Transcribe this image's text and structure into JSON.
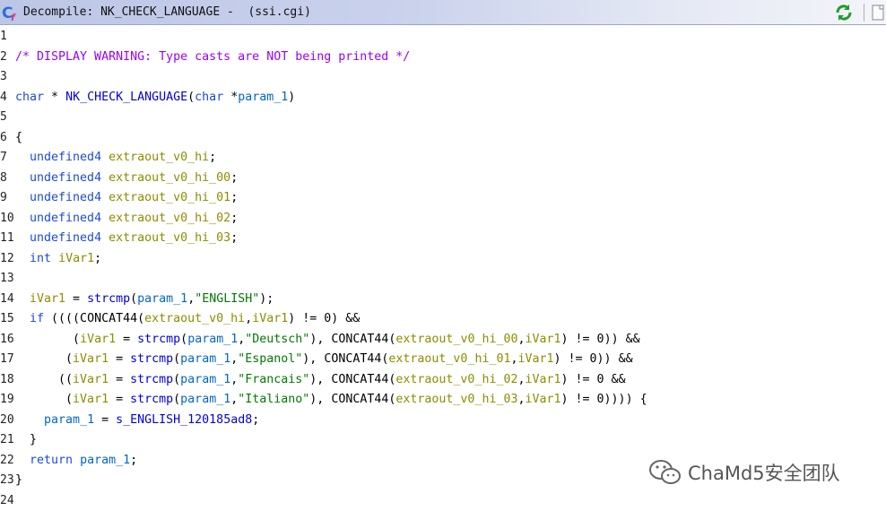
{
  "window": {
    "title": "Decompile: NK_CHECK_LANGUAGE -  (ssi.cgi)",
    "icons": [
      "decompile-icon",
      "refresh-icon",
      "copy-icon"
    ]
  },
  "code": {
    "line_numbers": [
      "1",
      "2",
      "3",
      "4",
      "5",
      "6",
      "7",
      "8",
      "9",
      "10",
      "11",
      "12",
      "13",
      "14",
      "15",
      "16",
      "17",
      "18",
      "19",
      "20",
      "21",
      "22",
      "23",
      "24"
    ],
    "lines": [
      [],
      [
        {
          "t": "/* DISPLAY WARNING: Type casts are NOT being printed */",
          "c": "c"
        }
      ],
      [],
      [
        {
          "t": "char",
          "c": "k"
        },
        {
          "t": " * ",
          "c": "n"
        },
        {
          "t": "NK_CHECK_LANGUAGE",
          "c": "f"
        },
        {
          "t": "(",
          "c": "n"
        },
        {
          "t": "char",
          "c": "k"
        },
        {
          "t": " *",
          "c": "n"
        },
        {
          "t": "param_1",
          "c": "pr"
        },
        {
          "t": ")",
          "c": "n"
        }
      ],
      [],
      [
        {
          "t": "{",
          "c": "n"
        }
      ],
      [
        {
          "t": "  ",
          "c": "n"
        },
        {
          "t": "undefined4",
          "c": "k"
        },
        {
          "t": " ",
          "c": "n"
        },
        {
          "t": "extraout_v0_hi",
          "c": "v"
        },
        {
          "t": ";",
          "c": "n"
        }
      ],
      [
        {
          "t": "  ",
          "c": "n"
        },
        {
          "t": "undefined4",
          "c": "k"
        },
        {
          "t": " ",
          "c": "n"
        },
        {
          "t": "extraout_v0_hi_00",
          "c": "v"
        },
        {
          "t": ";",
          "c": "n"
        }
      ],
      [
        {
          "t": "  ",
          "c": "n"
        },
        {
          "t": "undefined4",
          "c": "k"
        },
        {
          "t": " ",
          "c": "n"
        },
        {
          "t": "extraout_v0_hi_01",
          "c": "v"
        },
        {
          "t": ";",
          "c": "n"
        }
      ],
      [
        {
          "t": "  ",
          "c": "n"
        },
        {
          "t": "undefined4",
          "c": "k"
        },
        {
          "t": " ",
          "c": "n"
        },
        {
          "t": "extraout_v0_hi_02",
          "c": "v"
        },
        {
          "t": ";",
          "c": "n"
        }
      ],
      [
        {
          "t": "  ",
          "c": "n"
        },
        {
          "t": "undefined4",
          "c": "k"
        },
        {
          "t": " ",
          "c": "n"
        },
        {
          "t": "extraout_v0_hi_03",
          "c": "v"
        },
        {
          "t": ";",
          "c": "n"
        }
      ],
      [
        {
          "t": "  ",
          "c": "n"
        },
        {
          "t": "int",
          "c": "k"
        },
        {
          "t": " ",
          "c": "n"
        },
        {
          "t": "iVar1",
          "c": "v"
        },
        {
          "t": ";",
          "c": "n"
        }
      ],
      [],
      [
        {
          "t": "  ",
          "c": "n"
        },
        {
          "t": "iVar1",
          "c": "v"
        },
        {
          "t": " = ",
          "c": "n"
        },
        {
          "t": "strcmp",
          "c": "f"
        },
        {
          "t": "(",
          "c": "n"
        },
        {
          "t": "param_1",
          "c": "pr"
        },
        {
          "t": ",",
          "c": "n"
        },
        {
          "t": "\"ENGLISH\"",
          "c": "s"
        },
        {
          "t": ");",
          "c": "n"
        }
      ],
      [
        {
          "t": "  ",
          "c": "n"
        },
        {
          "t": "if",
          "c": "k"
        },
        {
          "t": " ((((CONCAT44(",
          "c": "n"
        },
        {
          "t": "extraout_v0_hi",
          "c": "v"
        },
        {
          "t": ",",
          "c": "n"
        },
        {
          "t": "iVar1",
          "c": "v"
        },
        {
          "t": ") != 0) &&",
          "c": "n"
        }
      ],
      [
        {
          "t": "        (",
          "c": "n"
        },
        {
          "t": "iVar1",
          "c": "v"
        },
        {
          "t": " = ",
          "c": "n"
        },
        {
          "t": "strcmp",
          "c": "f"
        },
        {
          "t": "(",
          "c": "n"
        },
        {
          "t": "param_1",
          "c": "pr"
        },
        {
          "t": ",",
          "c": "n"
        },
        {
          "t": "\"Deutsch\"",
          "c": "s"
        },
        {
          "t": "), CONCAT44(",
          "c": "n"
        },
        {
          "t": "extraout_v0_hi_00",
          "c": "v"
        },
        {
          "t": ",",
          "c": "n"
        },
        {
          "t": "iVar1",
          "c": "v"
        },
        {
          "t": ") != 0)) &&",
          "c": "n"
        }
      ],
      [
        {
          "t": "       (",
          "c": "n"
        },
        {
          "t": "iVar1",
          "c": "v"
        },
        {
          "t": " = ",
          "c": "n"
        },
        {
          "t": "strcmp",
          "c": "f"
        },
        {
          "t": "(",
          "c": "n"
        },
        {
          "t": "param_1",
          "c": "pr"
        },
        {
          "t": ",",
          "c": "n"
        },
        {
          "t": "\"Espanol\"",
          "c": "s"
        },
        {
          "t": "), CONCAT44(",
          "c": "n"
        },
        {
          "t": "extraout_v0_hi_01",
          "c": "v"
        },
        {
          "t": ",",
          "c": "n"
        },
        {
          "t": "iVar1",
          "c": "v"
        },
        {
          "t": ") != 0)) &&",
          "c": "n"
        }
      ],
      [
        {
          "t": "      ((",
          "c": "n"
        },
        {
          "t": "iVar1",
          "c": "v"
        },
        {
          "t": " = ",
          "c": "n"
        },
        {
          "t": "strcmp",
          "c": "f"
        },
        {
          "t": "(",
          "c": "n"
        },
        {
          "t": "param_1",
          "c": "pr"
        },
        {
          "t": ",",
          "c": "n"
        },
        {
          "t": "\"Francais\"",
          "c": "s"
        },
        {
          "t": "), CONCAT44(",
          "c": "n"
        },
        {
          "t": "extraout_v0_hi_02",
          "c": "v"
        },
        {
          "t": ",",
          "c": "n"
        },
        {
          "t": "iVar1",
          "c": "v"
        },
        {
          "t": ") != 0 &&",
          "c": "n"
        }
      ],
      [
        {
          "t": "       (",
          "c": "n"
        },
        {
          "t": "iVar1",
          "c": "v"
        },
        {
          "t": " = ",
          "c": "n"
        },
        {
          "t": "strcmp",
          "c": "f"
        },
        {
          "t": "(",
          "c": "n"
        },
        {
          "t": "param_1",
          "c": "pr"
        },
        {
          "t": ",",
          "c": "n"
        },
        {
          "t": "\"Italiano\"",
          "c": "s"
        },
        {
          "t": "), CONCAT44(",
          "c": "n"
        },
        {
          "t": "extraout_v0_hi_03",
          "c": "v"
        },
        {
          "t": ",",
          "c": "n"
        },
        {
          "t": "iVar1",
          "c": "v"
        },
        {
          "t": ") != 0)))) {",
          "c": "n"
        }
      ],
      [
        {
          "t": "    ",
          "c": "n"
        },
        {
          "t": "param_1",
          "c": "pr"
        },
        {
          "t": " = ",
          "c": "n"
        },
        {
          "t": "s_ENGLISH_120185ad8",
          "c": "f"
        },
        {
          "t": ";",
          "c": "n"
        }
      ],
      [
        {
          "t": "  }",
          "c": "n"
        }
      ],
      [
        {
          "t": "  ",
          "c": "n"
        },
        {
          "t": "return",
          "c": "k"
        },
        {
          "t": " ",
          "c": "n"
        },
        {
          "t": "param_1",
          "c": "pr"
        },
        {
          "t": ";",
          "c": "n"
        }
      ],
      [
        {
          "t": "}",
          "c": "n"
        }
      ],
      []
    ]
  },
  "watermark": {
    "text": "ChaMd5安全团队",
    "icon": "wechat-icon"
  },
  "colors": {
    "comment": "#9900ff",
    "keyword": "#1d4bd9",
    "function": "#0000e0",
    "param": "#0066cc",
    "variable": "#8e8d00",
    "string": "#007a00"
  }
}
